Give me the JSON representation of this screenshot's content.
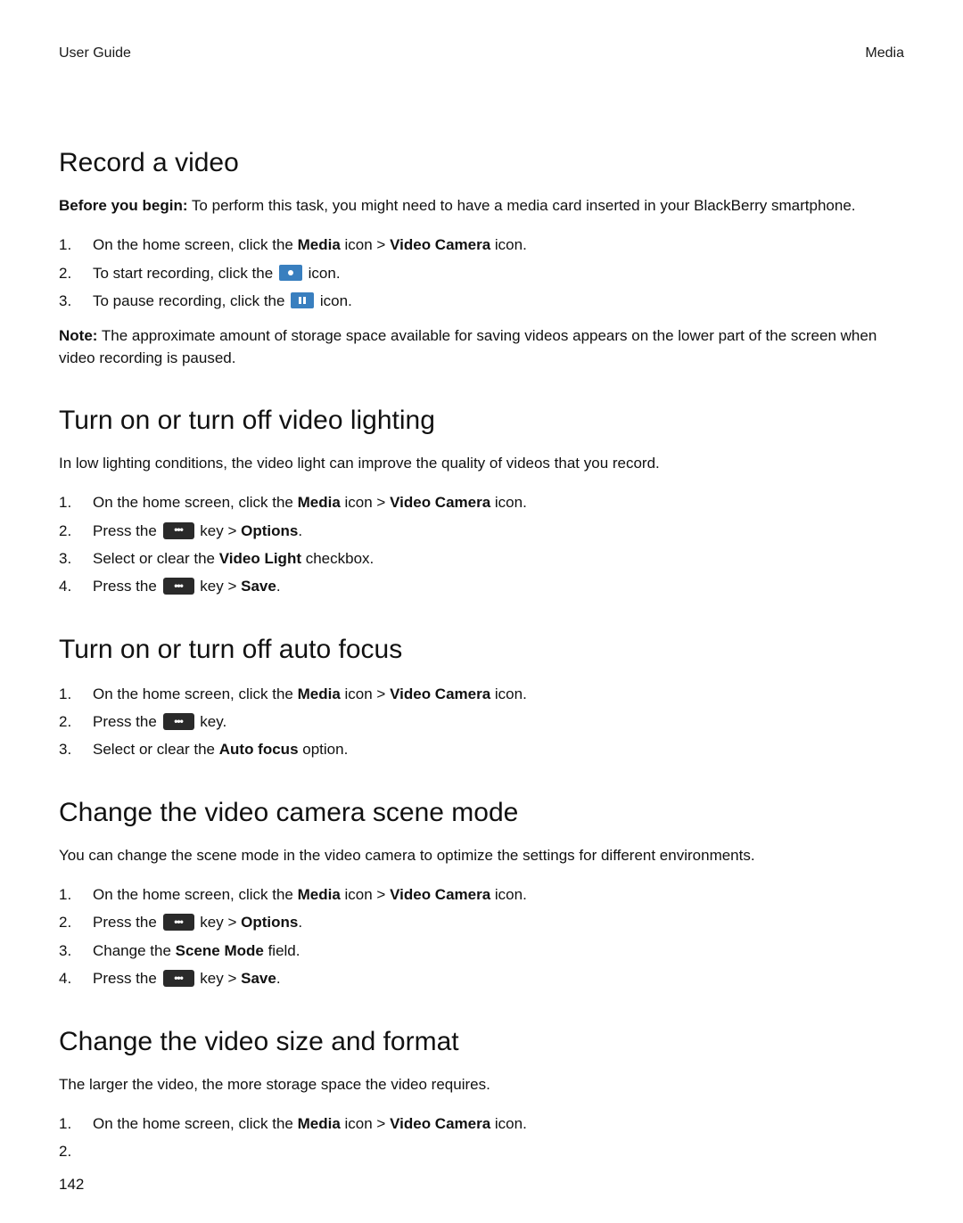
{
  "header": {
    "left": "User Guide",
    "right": "Media"
  },
  "page_number": "142",
  "text": {
    "before_you_begin_label": "Before you begin:",
    "note_label": "Note:",
    "on_home_prefix": "On the home screen, click the ",
    "media_bold": "Media",
    "icon_gt": " icon > ",
    "video_camera_bold": "Video Camera",
    "icon_period": " icon.",
    "press_the": "Press the ",
    "key_period": " key.",
    "key_gt": " key > ",
    "options_bold": "Options",
    "save_bold": "Save",
    "period": ".",
    "start_recording_prefix": "To start recording, click the ",
    "pause_recording_prefix": "To pause recording, click the ",
    "icon_word_period": " icon.",
    "select_clear_prefix": "Select or clear the ",
    "video_light_bold": "Video Light",
    "checkbox_suffix": " checkbox.",
    "auto_focus_bold": "Auto focus",
    "option_suffix": " option.",
    "change_the": "Change the ",
    "scene_mode_bold": "Scene Mode",
    "field_suffix": " field."
  },
  "sections": {
    "record": {
      "title": "Record a video",
      "before_you_begin_body": " To perform this task, you might need to have a media card inserted in your BlackBerry smartphone.",
      "note_body": " The approximate amount of storage space available for saving videos appears on the lower part of the screen when video recording is paused."
    },
    "lighting": {
      "title": "Turn on or turn off video lighting",
      "intro": "In low lighting conditions, the video light can improve the quality of videos that you record."
    },
    "autofocus": {
      "title": "Turn on or turn off auto focus"
    },
    "scene": {
      "title": "Change the video camera scene mode",
      "intro": "You can change the scene mode in the video camera to optimize the settings for different environments."
    },
    "size": {
      "title": "Change the video size and format",
      "intro": "The larger the video, the more storage space the video requires."
    }
  },
  "nums": {
    "n1": "1.",
    "n2": "2.",
    "n3": "3.",
    "n4": "4."
  },
  "icons": {
    "bbkey_glyph": "•••"
  }
}
